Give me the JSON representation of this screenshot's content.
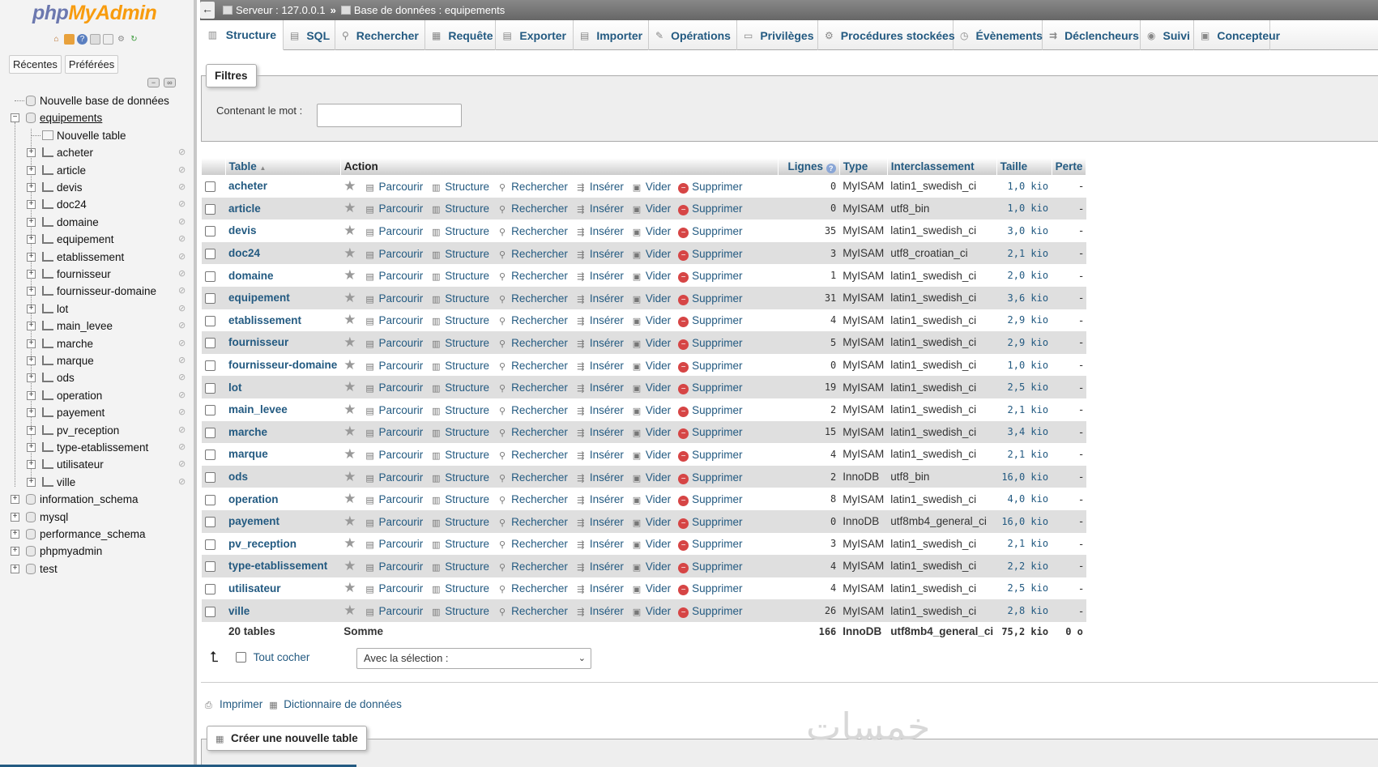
{
  "app": {
    "logo_part1": "php",
    "logo_part2": "MyAdmin"
  },
  "sidebar": {
    "tabs": [
      "Récentes",
      "Préférées"
    ],
    "new_db": "Nouvelle base de données",
    "current_db": "equipements",
    "new_table": "Nouvelle table",
    "tables": [
      "acheter",
      "article",
      "devis",
      "doc24",
      "domaine",
      "equipement",
      "etablissement",
      "fournisseur",
      "fournisseur-domaine",
      "lot",
      "main_levee",
      "marche",
      "marque",
      "ods",
      "operation",
      "payement",
      "pv_reception",
      "type-etablissement",
      "utilisateur",
      "ville"
    ],
    "other_dbs": [
      "information_schema",
      "mysql",
      "performance_schema",
      "phpmyadmin",
      "test"
    ]
  },
  "breadcrumb": {
    "server": "Serveur : 127.0.0.1",
    "sep": "»",
    "database": "Base de données : equipements"
  },
  "tabs": [
    {
      "label": "Structure",
      "icon": "structure-icon",
      "glyph": "▥"
    },
    {
      "label": "SQL",
      "icon": "sql-icon",
      "glyph": "▤"
    },
    {
      "label": "Rechercher",
      "icon": "search-icon",
      "glyph": "⚲"
    },
    {
      "label": "Requête",
      "icon": "query-icon",
      "glyph": "▦"
    },
    {
      "label": "Exporter",
      "icon": "export-icon",
      "glyph": "▤"
    },
    {
      "label": "Importer",
      "icon": "import-icon",
      "glyph": "▤"
    },
    {
      "label": "Opérations",
      "icon": "wrench-icon",
      "glyph": "✎"
    },
    {
      "label": "Privilèges",
      "icon": "privileges-icon",
      "glyph": "▭"
    },
    {
      "label": "Procédures stockées",
      "icon": "routines-icon",
      "glyph": "⚙"
    },
    {
      "label": "Évènements",
      "icon": "clock-icon",
      "glyph": "◷"
    },
    {
      "label": "Déclencheurs",
      "icon": "triggers-icon",
      "glyph": "⇉"
    },
    {
      "label": "Suivi",
      "icon": "eye-icon",
      "glyph": "◉"
    },
    {
      "label": "Concepteur",
      "icon": "designer-icon",
      "glyph": "▣"
    }
  ],
  "filters": {
    "legend": "Filtres",
    "label": "Contenant le mot :",
    "value": ""
  },
  "table": {
    "headers": {
      "table": "Table",
      "sort_indicator": "▲",
      "action": "Action",
      "rows": "Lignes",
      "type": "Type",
      "collation": "Interclassement",
      "size": "Taille",
      "overhead": "Perte"
    },
    "actions": [
      "Parcourir",
      "Structure",
      "Rechercher",
      "Insérer",
      "Vider",
      "Supprimer"
    ],
    "rows": [
      {
        "name": "acheter",
        "rows": "0",
        "type": "MyISAM",
        "collation": "latin1_swedish_ci",
        "size": "1,0 kio",
        "overhead": "-"
      },
      {
        "name": "article",
        "rows": "0",
        "type": "MyISAM",
        "collation": "utf8_bin",
        "size": "1,0 kio",
        "overhead": "-"
      },
      {
        "name": "devis",
        "rows": "35",
        "type": "MyISAM",
        "collation": "latin1_swedish_ci",
        "size": "3,0 kio",
        "overhead": "-"
      },
      {
        "name": "doc24",
        "rows": "3",
        "type": "MyISAM",
        "collation": "utf8_croatian_ci",
        "size": "2,1 kio",
        "overhead": "-"
      },
      {
        "name": "domaine",
        "rows": "1",
        "type": "MyISAM",
        "collation": "latin1_swedish_ci",
        "size": "2,0 kio",
        "overhead": "-"
      },
      {
        "name": "equipement",
        "rows": "31",
        "type": "MyISAM",
        "collation": "latin1_swedish_ci",
        "size": "3,6 kio",
        "overhead": "-"
      },
      {
        "name": "etablissement",
        "rows": "4",
        "type": "MyISAM",
        "collation": "latin1_swedish_ci",
        "size": "2,9 kio",
        "overhead": "-"
      },
      {
        "name": "fournisseur",
        "rows": "5",
        "type": "MyISAM",
        "collation": "latin1_swedish_ci",
        "size": "2,9 kio",
        "overhead": "-"
      },
      {
        "name": "fournisseur-domaine",
        "rows": "0",
        "type": "MyISAM",
        "collation": "latin1_swedish_ci",
        "size": "1,0 kio",
        "overhead": "-"
      },
      {
        "name": "lot",
        "rows": "19",
        "type": "MyISAM",
        "collation": "latin1_swedish_ci",
        "size": "2,5 kio",
        "overhead": "-"
      },
      {
        "name": "main_levee",
        "rows": "2",
        "type": "MyISAM",
        "collation": "latin1_swedish_ci",
        "size": "2,1 kio",
        "overhead": "-"
      },
      {
        "name": "marche",
        "rows": "15",
        "type": "MyISAM",
        "collation": "latin1_swedish_ci",
        "size": "3,4 kio",
        "overhead": "-"
      },
      {
        "name": "marque",
        "rows": "4",
        "type": "MyISAM",
        "collation": "latin1_swedish_ci",
        "size": "2,1 kio",
        "overhead": "-"
      },
      {
        "name": "ods",
        "rows": "2",
        "type": "InnoDB",
        "collation": "utf8_bin",
        "size": "16,0 kio",
        "overhead": "-"
      },
      {
        "name": "operation",
        "rows": "8",
        "type": "MyISAM",
        "collation": "latin1_swedish_ci",
        "size": "4,0 kio",
        "overhead": "-"
      },
      {
        "name": "payement",
        "rows": "0",
        "type": "InnoDB",
        "collation": "utf8mb4_general_ci",
        "size": "16,0 kio",
        "overhead": "-"
      },
      {
        "name": "pv_reception",
        "rows": "3",
        "type": "MyISAM",
        "collation": "latin1_swedish_ci",
        "size": "2,1 kio",
        "overhead": "-"
      },
      {
        "name": "type-etablissement",
        "rows": "4",
        "type": "MyISAM",
        "collation": "latin1_swedish_ci",
        "size": "2,2 kio",
        "overhead": "-"
      },
      {
        "name": "utilisateur",
        "rows": "4",
        "type": "MyISAM",
        "collation": "latin1_swedish_ci",
        "size": "2,5 kio",
        "overhead": "-"
      },
      {
        "name": "ville",
        "rows": "26",
        "type": "MyISAM",
        "collation": "latin1_swedish_ci",
        "size": "2,8 kio",
        "overhead": "-"
      }
    ],
    "footer": {
      "count": "20 tables",
      "label": "Somme",
      "rows": "166",
      "type": "InnoDB",
      "collation": "utf8mb4_general_ci",
      "size": "75,2 kio",
      "overhead": "0 o"
    }
  },
  "bulk": {
    "check_all": "Tout cocher",
    "select_placeholder": "Avec la sélection :"
  },
  "links": {
    "print": "Imprimer",
    "dictionary": "Dictionnaire de données"
  },
  "create_table": "Créer une nouvelle table",
  "watermark": "خمسات",
  "colors": {
    "link": "#235a81",
    "logo_php": "#6c78af",
    "logo_myadmin": "#f89c0e",
    "delete_icon": "#d64545"
  }
}
